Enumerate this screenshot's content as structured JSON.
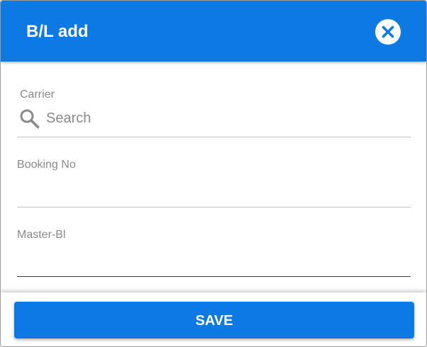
{
  "dialog": {
    "title": "B/L add",
    "close_icon": "close-icon"
  },
  "form": {
    "carrier": {
      "label": "Carrier",
      "icon": "search-icon",
      "placeholder": "Search",
      "value": ""
    },
    "booking_no": {
      "label": "Booking No",
      "value": ""
    },
    "master_bl": {
      "label": "Master-Bl",
      "value": ""
    }
  },
  "footer": {
    "save_label": "SAVE"
  },
  "colors": {
    "primary": "#0d79e3",
    "label": "#8a8a8a",
    "underline": "#c2c2c2",
    "underline_active": "#3a3a3a"
  }
}
